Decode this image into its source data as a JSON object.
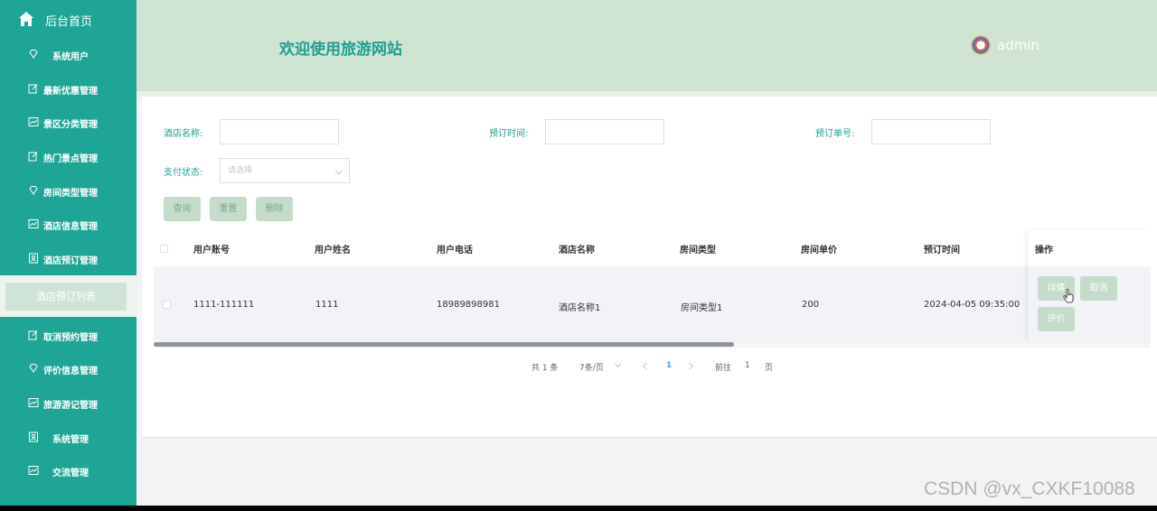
{
  "sidebar": {
    "home_label": "后台首页",
    "items": [
      {
        "label": "系统用户",
        "icon": "diamond-icon"
      },
      {
        "label": "最新优惠管理",
        "icon": "edit-icon"
      },
      {
        "label": "景区分类管理",
        "icon": "chart-icon"
      },
      {
        "label": "热门景点管理",
        "icon": "edit-icon"
      },
      {
        "label": "房间类型管理",
        "icon": "diamond-icon"
      },
      {
        "label": "酒店信息管理",
        "icon": "chart-icon"
      },
      {
        "label": "酒店预订管理",
        "icon": "user-card-icon"
      },
      {
        "label": "取消预约管理",
        "icon": "edit-icon"
      },
      {
        "label": "评价信息管理",
        "icon": "diamond-icon"
      },
      {
        "label": "旅游游记管理",
        "icon": "chart-icon"
      },
      {
        "label": "系统管理",
        "icon": "user-card-icon"
      },
      {
        "label": "交流管理",
        "icon": "chart-icon"
      }
    ],
    "active_sub": "酒店预订列表"
  },
  "header": {
    "welcome": "欢迎使用旅游网站",
    "username": "admin"
  },
  "filters": {
    "hotel_name_label": "酒店名称:",
    "booking_time_label": "预订时间:",
    "booking_no_label": "预订单号:",
    "pay_status_label": "支付状态:",
    "pay_status_placeholder": "请选择",
    "query_button": "查询",
    "reset_button": "重置",
    "delete_button": "删除"
  },
  "table": {
    "columns": [
      "用户账号",
      "用户姓名",
      "用户电话",
      "酒店名称",
      "房间类型",
      "房间单价",
      "预订时间"
    ],
    "action_column": "操作",
    "rows": [
      [
        "1111-111111",
        "1111",
        "18989898981",
        "酒店名称1",
        "房间类型1",
        "200",
        "2024-04-05 09:35:00"
      ]
    ],
    "actions": {
      "detail": "详情",
      "cancel": "取消",
      "review": "评价"
    }
  },
  "pagination": {
    "total": "共 1 条",
    "page_size": "7条/页",
    "current_page": "1",
    "goto_prefix": "前往",
    "goto_value": "1",
    "goto_suffix": "页"
  },
  "watermark": "CSDN @vx_CXKF10088",
  "colors": {
    "sidebar": "#1fa596",
    "header": "#cfe4d2",
    "accent": "#1f9f8f",
    "button": "#c5dccb",
    "page_active": "#409eff"
  }
}
